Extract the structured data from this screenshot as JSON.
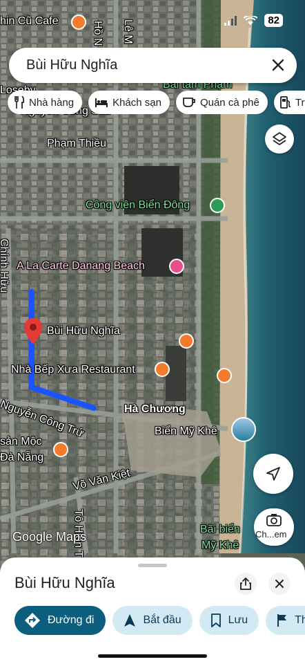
{
  "status": {
    "battery": "82"
  },
  "search": {
    "query": "Bùi Hữu Nghĩa"
  },
  "chips": [
    {
      "label": "Nhà hàng",
      "icon": "fork-knife-icon"
    },
    {
      "label": "Khách sạn",
      "icon": "bed-icon"
    },
    {
      "label": "Quán cà phê",
      "icon": "coffee-cup-icon"
    },
    {
      "label": "Trạ",
      "icon": "gas-pump-icon"
    }
  ],
  "map_labels": {
    "cafe": "hin Cũ Cafe",
    "ho": "Hồ N",
    "le": "Lê M",
    "loseby": "Loseby",
    "nguyen_cong_sao": "Nguyễn Công Sáu",
    "beach_top": "Bãi tắm Phạm",
    "pham_thieu": "Phạm Thiều",
    "park": "Công viên Biển Đông",
    "chinh_huu": "Chính Hữu",
    "a_la_carte": "A La Carte Danang Beach",
    "pin_label": "Bùi Hữu Nghĩa",
    "nha_bep": "Nhà Bếp Xưa Restaurant",
    "nguyen_cong_tru": "Nguyễn Công Trứ",
    "ha_chuong": "Hà Chương",
    "bien_my_khe": "Biển Mỹ Khê",
    "san_moc_1": "sản Mộc",
    "san_moc_2": "Đà Nẵng",
    "vo_van_kiet": "Võ Văn Kiệt",
    "to_hien": "Tô Hiến T",
    "bai_bien_1": "Bãi biển",
    "bai_bien_2": "Mỹ Khê",
    "google": "Google Maps",
    "lens": "Ch...em"
  },
  "sheet": {
    "title": "Bùi Hữu Nghĩa",
    "actions": [
      {
        "label": "Đường đi",
        "icon": "directions-icon"
      },
      {
        "label": "Bắt đầu",
        "icon": "navigation-arrow-icon"
      },
      {
        "label": "Lưu",
        "icon": "bookmark-icon"
      },
      {
        "label": "Thê",
        "icon": "flag-icon"
      }
    ]
  },
  "colors": {
    "route": "#1a53ff",
    "pin": "#e53935",
    "primary_action": "#0b5e7d",
    "secondary_action": "#d3eaf5",
    "sea": "#1f5f70",
    "sand": "#c9b596"
  }
}
